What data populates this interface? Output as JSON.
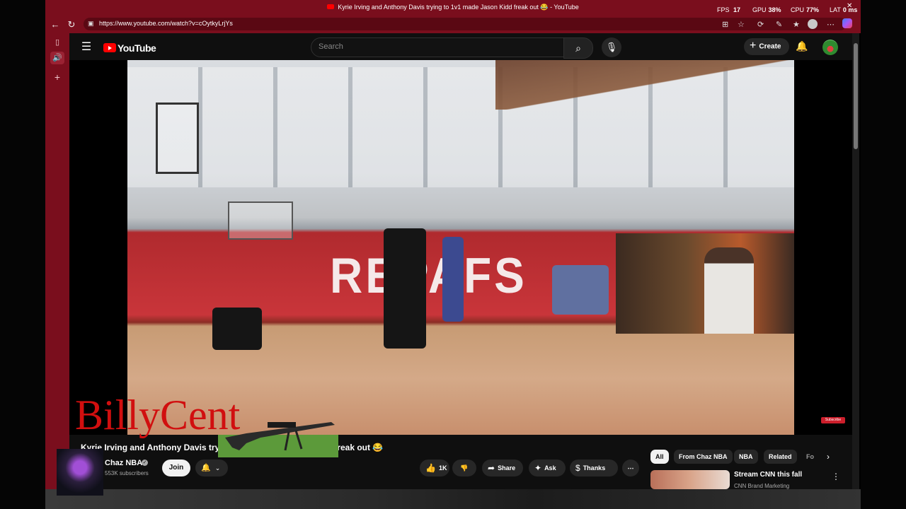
{
  "browser": {
    "tab_title": "Kyrie Irving and Anthony Davis trying to 1v1 made Jason Kidd freak out 😂 - YouTube",
    "url": "https://www.youtube.com/watch?v=cOytkyLrjYs",
    "perf": {
      "fps_label": "FPS",
      "fps_value": "17",
      "gpu_label": "GPU",
      "gpu_value": "38%",
      "cpu_label": "CPU",
      "cpu_value": "77%",
      "lat_label": "LAT",
      "lat_value": "0 ms"
    },
    "accent_color": "#7a0e1d"
  },
  "youtube": {
    "logo_text": "YouTube",
    "search_placeholder": "Search",
    "create_label": "Create",
    "video": {
      "wall_text": "REPAFS",
      "watermark": "Subscribe"
    },
    "overlay_text": "BillyCent",
    "title": "Kyrie Irving and Anthony Davis trying to 1v1 made Jason Kidd freak out 😂",
    "channel": {
      "name": "Chaz NBA",
      "subscribers": "553K subscribers",
      "join_label": "Join"
    },
    "actions": {
      "likes": "1K",
      "share": "Share",
      "ask": "Ask",
      "thanks": "Thanks"
    },
    "chips": [
      "All",
      "From Chaz NBA",
      "NBA",
      "Related",
      "Fo"
    ],
    "recommendation": {
      "title": "Stream CNN this fall",
      "channel": "CNN Brand Marketing"
    }
  }
}
